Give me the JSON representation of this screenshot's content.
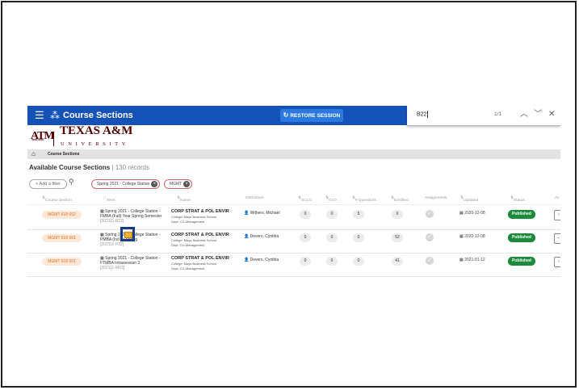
{
  "topbar": {
    "menu_icon": "hamburger-icon",
    "nodes_icon": "hierarchy-icon",
    "title": "Course Sections",
    "restore_label": "RESTORE SESSION",
    "restore_icon": "refresh-icon",
    "color": "#1452b8"
  },
  "find": {
    "query": "B22",
    "count": "1/1",
    "up": "^",
    "down": "v",
    "close": "✕"
  },
  "logo": {
    "mark": "ATM",
    "name": "TEXAS A&M",
    "sub": "UNIVERSITY",
    "color": "#500000"
  },
  "breadcrumb": {
    "home_icon": "home-icon",
    "label": "Course Sections"
  },
  "heading": {
    "title": "Available Course Sections",
    "count": "130 records"
  },
  "filters": {
    "add": "+ Add a filter",
    "search_icon": "search-icon",
    "chips": [
      "Spring 2021 - College Station",
      "MGMT"
    ]
  },
  "columns": [
    "Course Section",
    "Term",
    "Name",
    "Instructors",
    "SCLO",
    "CLO",
    "# Questions",
    "Enrolled",
    "Assignments",
    "Updated",
    "Status",
    "Ac"
  ],
  "rows": [
    {
      "section": "MGMT 618 652",
      "term_l1": "Spring 2021 - College Station -",
      "term_l2": "FMBA (Fall) Year Spring Semester",
      "term_code": "[202111-B22]",
      "name": "CORP STRAT & POL ENVIR",
      "college": "College: Mays Business School",
      "dept": "Dept: CG-Management",
      "instructor": "Withers, Michael",
      "sclo": "0",
      "clo": "0",
      "questions": "5",
      "enrolled": "0",
      "updated": "2020-12-08",
      "status": "Published"
    },
    {
      "section": "MGMT 618 661",
      "term_l1": "Spring 2021 - College Station -",
      "term_l2": "PMBA (Ind Yr Spring",
      "term_code": "[202111-P22]",
      "name": "CORP STRAT & POL ENVIR",
      "college": "College: Mays Business School",
      "dept": "Dept: CG-Management",
      "instructor": "Devers, Cynthia",
      "sclo": "0",
      "clo": "0",
      "questions": "0",
      "enrolled": "52",
      "updated": "2020-12-08",
      "status": "Published"
    },
    {
      "section": "MGMT 618 601",
      "term_l1": "Spring 2021 - College Station -",
      "term_l2": "FTMBA Intrasession 3",
      "term_code": "[202111-M03]",
      "name": "CORP STRAT & POL ENVIR",
      "college": "College: Mays Business School",
      "dept": "Dept: CG-Management",
      "instructor": "Devers, Cynthia",
      "sclo": "0",
      "clo": "0",
      "questions": "0",
      "enrolled": "41",
      "updated": "2021-01-12",
      "status": "Published"
    }
  ],
  "status_color": "#1b8a3b",
  "section_color": "#e07020"
}
